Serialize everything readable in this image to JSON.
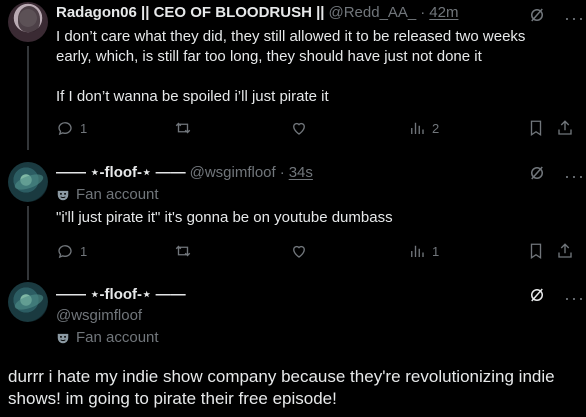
{
  "tweets": [
    {
      "name": "Radagon06 || CEO OF BLOODRUSH ||",
      "handle": "@Redd_AA_",
      "dot": "·",
      "time": "42m",
      "text": "I don’t care what they did, they still allowed it to be released two weeks early, which, is still far too long, they should have just not done it\n\nIf I don’t wanna be spoiled i’ll just pirate it",
      "replies": "1",
      "views": "2"
    },
    {
      "name": "—— ⋆-floof-⋆ ——",
      "handle": "@wsgimfloof",
      "dot": "·",
      "time": "34s",
      "fan_label": "Fan account",
      "text": "\"i'll just pirate it\" it's gonna be on youtube dumbass",
      "replies": "1",
      "views": "1"
    }
  ],
  "composer": {
    "name": "—— ⋆-floof-⋆ ——",
    "handle": "@wsgimfloof",
    "fan_label": "Fan account",
    "text": "durrr i hate my indie show company because they're revolutionizing indie shows! im going to pirate their free episode!"
  },
  "colors": {
    "background": "#000000",
    "text": "#e7e9ea",
    "muted": "#71767b",
    "line": "#333639"
  }
}
